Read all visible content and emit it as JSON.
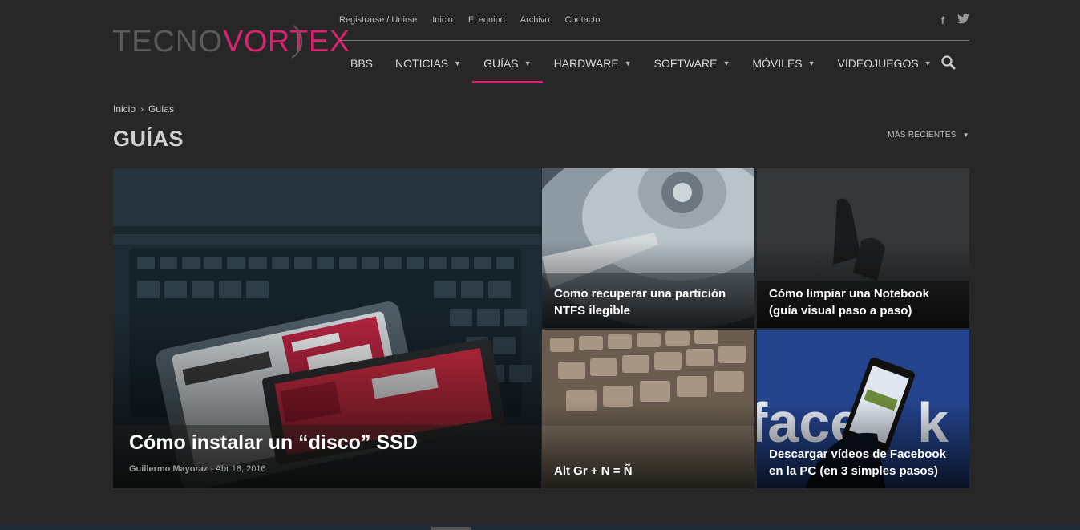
{
  "brand": {
    "logo_part1": "TECNO",
    "logo_part2": "VORTEX",
    "accent": "#d6246e"
  },
  "topbar": {
    "links": [
      "Registrarse / Unirse",
      "Inicio",
      "El equipo",
      "Archivo",
      "Contacto"
    ],
    "social": [
      {
        "icon": "facebook-icon",
        "glyph": "f"
      },
      {
        "icon": "twitter-icon",
        "glyph": "🐦"
      }
    ]
  },
  "nav": {
    "items": [
      {
        "label": "BBS",
        "dropdown": false
      },
      {
        "label": "NOTICIAS",
        "dropdown": true
      },
      {
        "label": "GUÍAS",
        "dropdown": true,
        "active": true
      },
      {
        "label": "HARDWARE",
        "dropdown": true
      },
      {
        "label": "SOFTWARE",
        "dropdown": true
      },
      {
        "label": "MÓVILES",
        "dropdown": true
      },
      {
        "label": "VIDEOJUEGOS",
        "dropdown": true
      }
    ],
    "chevron": "⌄"
  },
  "breadcrumb": {
    "home": "Inicio",
    "sep": "›",
    "current": "Guías"
  },
  "page": {
    "title": "GUÍAS",
    "sort_label": "MÁS RECIENTES",
    "sort_chevron": "⌄"
  },
  "articles": [
    {
      "title": "Cómo instalar un “disco” SSD",
      "author": "Guillermo Mayoraz",
      "dash": "-",
      "date": "Abr 18, 2016",
      "image": "ssd-photo"
    },
    {
      "title": "Como recuperar una partición NTFS ilegible",
      "image": "hard-drive-photo"
    },
    {
      "title": "Cómo limpiar una Notebook (guía visual paso a paso)",
      "image": "notebook-cleaning-photo"
    },
    {
      "title": "Alt Gr + N = Ñ",
      "image": "keyboard-photo"
    },
    {
      "title": "Descargar vídeos de Facebook en la PC (en 3 simples pasos)",
      "image": "facebook-phone-photo"
    }
  ]
}
